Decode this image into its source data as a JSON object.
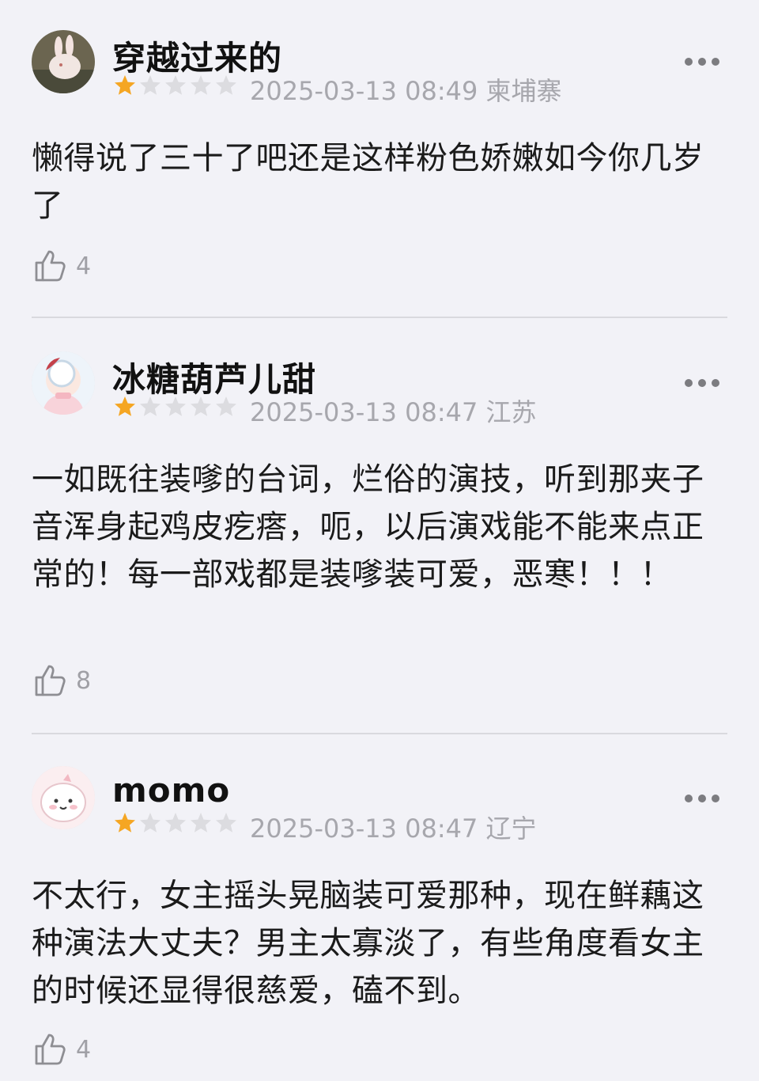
{
  "reviews": [
    {
      "username": "穿越过来的",
      "rating": 1,
      "rating_max": 5,
      "datetime": "2025-03-13 08:49",
      "location": "柬埔寨",
      "content": "懒得说了三十了吧还是这样粉色娇嫩如今你几岁了",
      "likes": "4"
    },
    {
      "username": "冰糖葫芦儿甜",
      "rating": 1,
      "rating_max": 5,
      "datetime": "2025-03-13 08:47",
      "location": "江苏",
      "content": "一如既往装嗲的台词，烂俗的演技，听到那夹子音浑身起鸡皮疙瘩，呃，以后演戏能不能来点正常的！每一部戏都是装嗲装可爱，恶寒！！！",
      "likes": "8"
    },
    {
      "username": "momo",
      "rating": 1,
      "rating_max": 5,
      "datetime": "2025-03-13 08:47",
      "location": "辽宁",
      "content": "不太行，女主摇头晃脑装可爱那种，现在鲜藕这种演法大丈夫？男主太寡淡了，有些角度看女主的时候还显得很慈爱，磕不到。",
      "likes": "4"
    }
  ],
  "colors": {
    "background": "#f2f2f7",
    "star_filled": "#f5a623",
    "star_empty": "#dcdce0",
    "meta_text": "#a7a7ad"
  }
}
